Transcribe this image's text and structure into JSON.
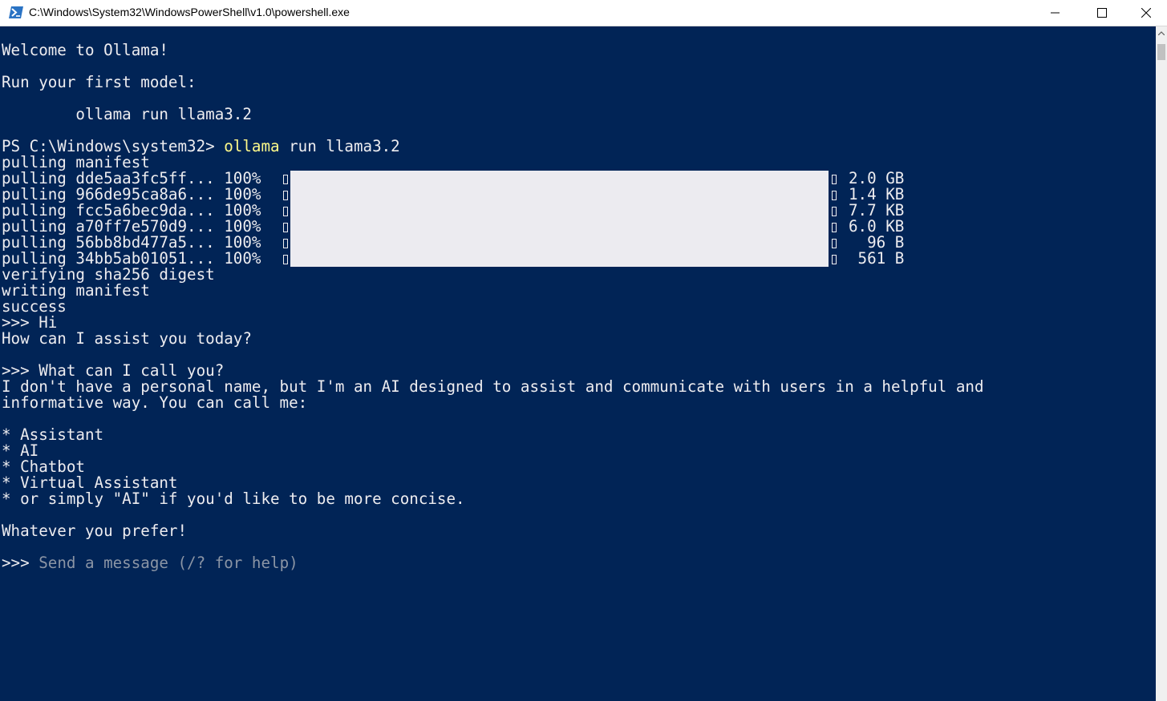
{
  "window": {
    "title": "C:\\Windows\\System32\\WindowsPowerShell\\v1.0\\powershell.exe",
    "icon": "powershell-icon",
    "controls": [
      "minimize-icon",
      "maximize-icon",
      "close-icon"
    ]
  },
  "colors": {
    "console_bg": "#012456",
    "text": "#eeedf0",
    "command_highlight": "#fffa8a",
    "placeholder": "#8b95a5",
    "progress_bar": "#ecebf0"
  },
  "console": {
    "welcome": "Welcome to Ollama!",
    "run_first": "Run your first model:",
    "example_cmd": "        ollama run llama3.2",
    "prompt_path": "PS C:\\Windows\\system32> ",
    "prompt_cmd_keyword": "ollama",
    "prompt_cmd_rest": " run llama3.2",
    "pulling_manifest": "pulling manifest",
    "pulls": [
      {
        "label": "pulling dde5aa3fc5ff... 100% ",
        "progress": 1.0,
        "size": "2.0 GB"
      },
      {
        "label": "pulling 966de95ca8a6... 100% ",
        "progress": 1.0,
        "size": "1.4 KB"
      },
      {
        "label": "pulling fcc5a6bec9da... 100% ",
        "progress": 1.0,
        "size": "7.7 KB"
      },
      {
        "label": "pulling a70ff7e570d9... 100% ",
        "progress": 1.0,
        "size": "6.0 KB"
      },
      {
        "label": "pulling 56bb8bd477a5... 100% ",
        "progress": 1.0,
        "size": "  96 B"
      },
      {
        "label": "pulling 34bb5ab01051... 100% ",
        "progress": 1.0,
        "size": " 561 B"
      }
    ],
    "verifying": "verifying sha256 digest",
    "writing": "writing manifest",
    "success": "success",
    "user_msg_1": ">>> Hi",
    "reply_1": "How can I assist you today?",
    "user_msg_2": ">>> What can I call you?",
    "reply_2_line1": "I don't have a personal name, but I'm an AI designed to assist and communicate with users in a helpful and",
    "reply_2_line2": "informative way. You can call me:",
    "bullets": [
      "* Assistant",
      "* AI",
      "* Chatbot",
      "* Virtual Assistant",
      "* or simply \"AI\" if you'd like to be more concise."
    ],
    "closing": "Whatever you prefer!",
    "input_prompt": ">>> ",
    "input_placeholder": "Send a message (/? for help)"
  }
}
